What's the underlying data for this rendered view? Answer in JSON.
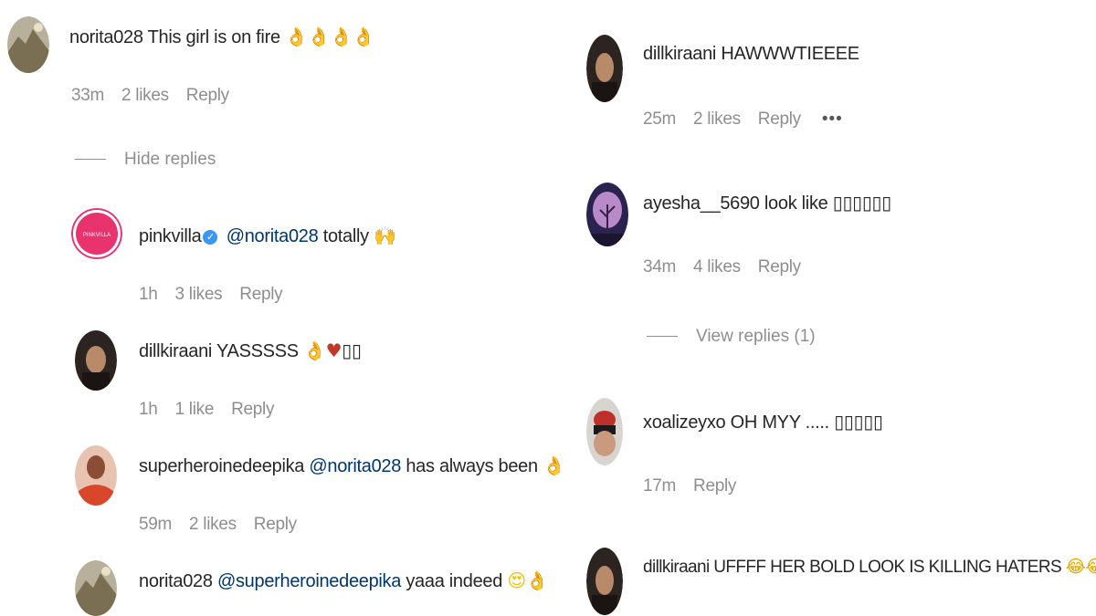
{
  "comments": {
    "c1": {
      "user": "norita028",
      "text": "This girl is on fire",
      "emoji": "👌👌👌👌",
      "time": "33m",
      "likes": "2 likes",
      "reply": "Reply"
    },
    "c1_toggle": "Hide replies",
    "r1": {
      "user": "pinkvilla",
      "avatar_text": "PINKVILLA",
      "mention": "@norita028",
      "text": "totally",
      "emoji": "🙌",
      "time": "1h",
      "likes": "3 likes",
      "reply": "Reply"
    },
    "r2": {
      "user": "dillkiraani",
      "text": "YASSSSS",
      "emoji": "👌♥",
      "boxes": "▯▯",
      "time": "1h",
      "likes": "1 like",
      "reply": "Reply"
    },
    "r3": {
      "user": "superheroinedeepika",
      "mention": "@norita028",
      "text": "has always been",
      "emoji": "👌",
      "time": "59m",
      "likes": "2 likes",
      "reply": "Reply"
    },
    "r4": {
      "user": "norita028",
      "mention": "@superheroinedeepika",
      "text": "yaaa indeed",
      "emoji": "😍👌"
    },
    "c2": {
      "user": "dillkiraani",
      "text": "HAWWWTIEEEE",
      "time": "25m",
      "likes": "2 likes",
      "reply": "Reply",
      "more": "•••"
    },
    "c3": {
      "user": "ayesha__5690",
      "text": "look like",
      "boxes": "▯▯▯▯▯▯",
      "time": "34m",
      "likes": "4 likes",
      "reply": "Reply"
    },
    "c3_toggle": "View replies (1)",
    "c4": {
      "user": "xoalizeyxo",
      "text": "OH MYY .....",
      "boxes": "▯▯▯▯▯",
      "time": "17m",
      "reply": "Reply"
    },
    "c5": {
      "user": "dillkiraani",
      "text": "UFFFF HER BOLD LOOK IS KILLING HATERS",
      "emoji": "😂😂😂😂"
    }
  },
  "colors": {
    "username": "#262626",
    "meta": "#8e8e8e",
    "mention": "#00376b",
    "verified": "#3897f0",
    "pinkvilla": "#e8336e"
  },
  "icons": [
    "verified-badge-icon",
    "more-options-icon"
  ]
}
